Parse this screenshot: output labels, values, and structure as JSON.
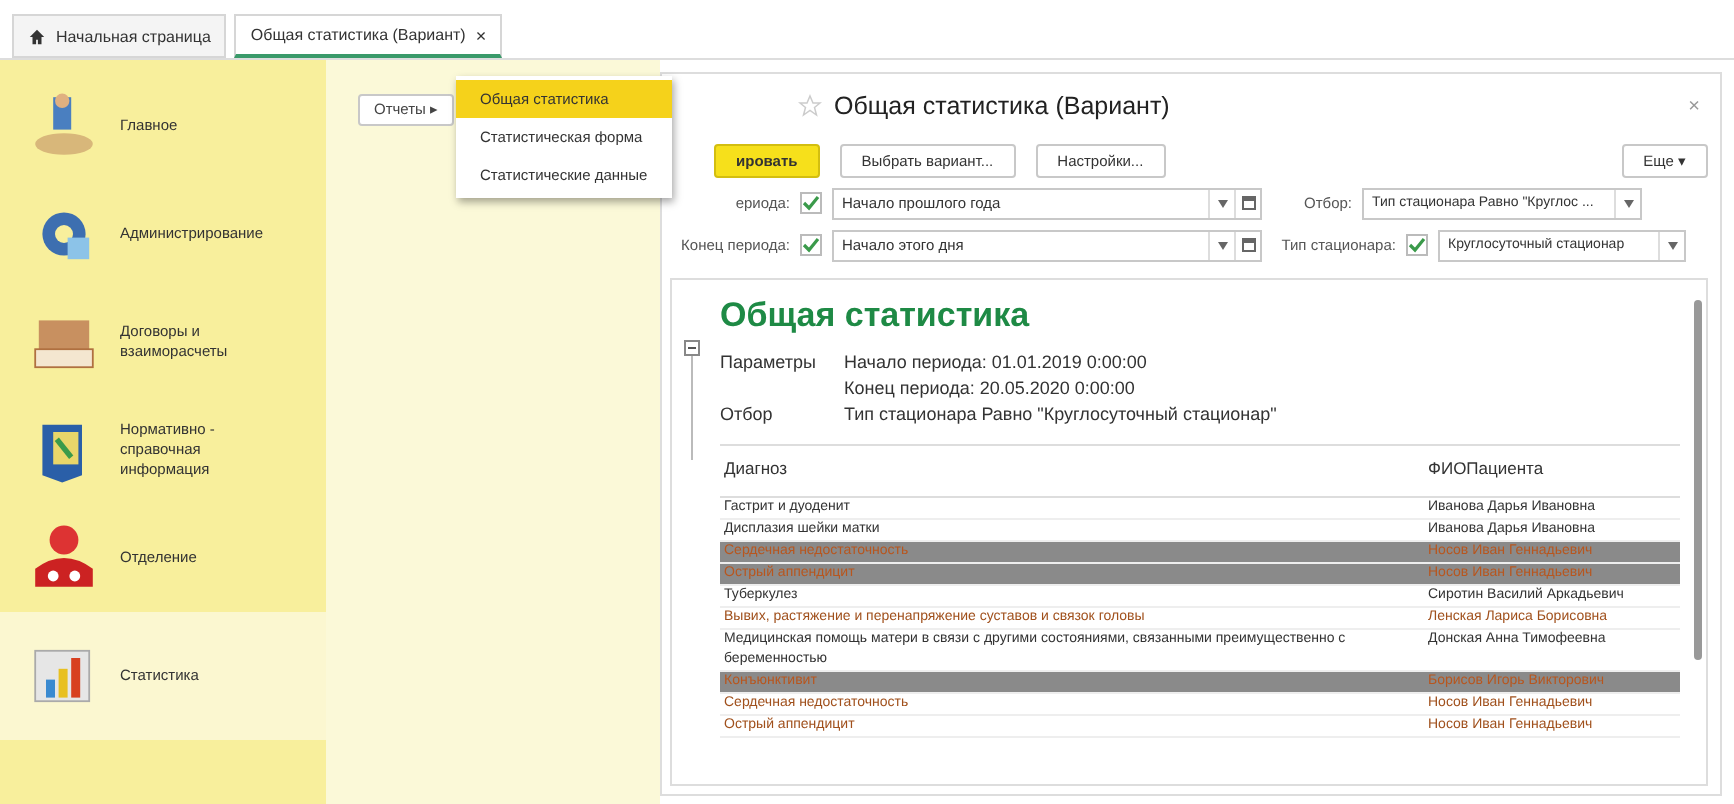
{
  "tabs": [
    {
      "label": "Начальная страница",
      "kind": "home",
      "selected": false
    },
    {
      "label": "Общая статистика (Вариант)",
      "kind": "doc",
      "selected": true,
      "close": "×"
    }
  ],
  "sidebar": {
    "items": [
      {
        "label": "Главное",
        "selected": false
      },
      {
        "label": "Администрирование",
        "selected": false
      },
      {
        "label": "Договоры и взаиморасчеты",
        "selected": false
      },
      {
        "label": "Нормативно - справочная информация",
        "selected": false
      },
      {
        "label": "Отделение",
        "selected": false
      },
      {
        "label": "Статистика",
        "selected": true
      }
    ]
  },
  "reports_button": "Отчеты ▸",
  "reports_menu": [
    {
      "label": "Общая статистика",
      "selected": true
    },
    {
      "label": "Статистическая форма",
      "selected": false
    },
    {
      "label": "Статистические данные",
      "selected": false
    }
  ],
  "report_window": {
    "title": "Общая статистика (Вариант)",
    "close": "×",
    "toolbar": [
      {
        "label": "ировать",
        "kind": "primary"
      },
      {
        "label": "Выбрать вариант...",
        "kind": "normal"
      },
      {
        "label": "Настройки...",
        "kind": "normal"
      }
    ],
    "more": "Еще ▾",
    "params": [
      {
        "label": "ериода:",
        "checked": true,
        "value": "Начало прошлого года",
        "filter_label": "Отбор:",
        "filter_value": "Тип стационара Равно \"Круглос ..."
      },
      {
        "label": "Конец периода:",
        "checked": true,
        "value": "Начало этого дня",
        "filter_label": "Тип стационара:",
        "filter_checked": true,
        "filter_value": "Круглосуточный стационар"
      }
    ]
  },
  "report": {
    "title": "Общая статистика",
    "params_label": "Параметры",
    "params_lines": [
      "Начало периода: 01.01.2019 0:00:00",
      "Конец периода: 20.05.2020 0:00:00"
    ],
    "filter_label": "Отбор",
    "filter_value": "Тип стационара Равно \"Круглосуточный стационар\"",
    "columns": [
      "Диагноз",
      "ФИОПациента"
    ],
    "rows": [
      {
        "kind": "normal",
        "cells": [
          "Гастрит и дуоденит",
          "Иванова Дарья Ивановна"
        ]
      },
      {
        "kind": "normal",
        "cells": [
          "Дисплазия шейки матки",
          "Иванова Дарья Ивановна"
        ]
      },
      {
        "kind": "highlight",
        "cells": [
          "Сердечная недостаточность",
          "Носов Иван Геннадьевич"
        ]
      },
      {
        "kind": "highlight",
        "cells": [
          "Острый аппендицит",
          "Носов Иван Геннадьевич"
        ]
      },
      {
        "kind": "normal",
        "cells": [
          "Туберкулез",
          "Сиротин Василий Аркадьевич"
        ]
      },
      {
        "kind": "accent",
        "cells": [
          "Вывих, растяжение и перенапряжение суставов и связок головы",
          "Ленская Лариса Борисовна"
        ]
      },
      {
        "kind": "normal",
        "cells": [
          "Медицинская помощь матери в связи с другими состояниями, связанными преимущественно с беременностью",
          "Донская Анна Тимофеевна"
        ]
      },
      {
        "kind": "highlight",
        "cells": [
          "Конъюнктивит",
          "Борисов Игорь Викторович"
        ]
      },
      {
        "kind": "accent",
        "cells": [
          "Сердечная недостаточность",
          "Носов Иван Геннадьевич"
        ]
      },
      {
        "kind": "accent",
        "cells": [
          "Острый аппендицит",
          "Носов Иван Геннадьевич"
        ]
      }
    ]
  }
}
